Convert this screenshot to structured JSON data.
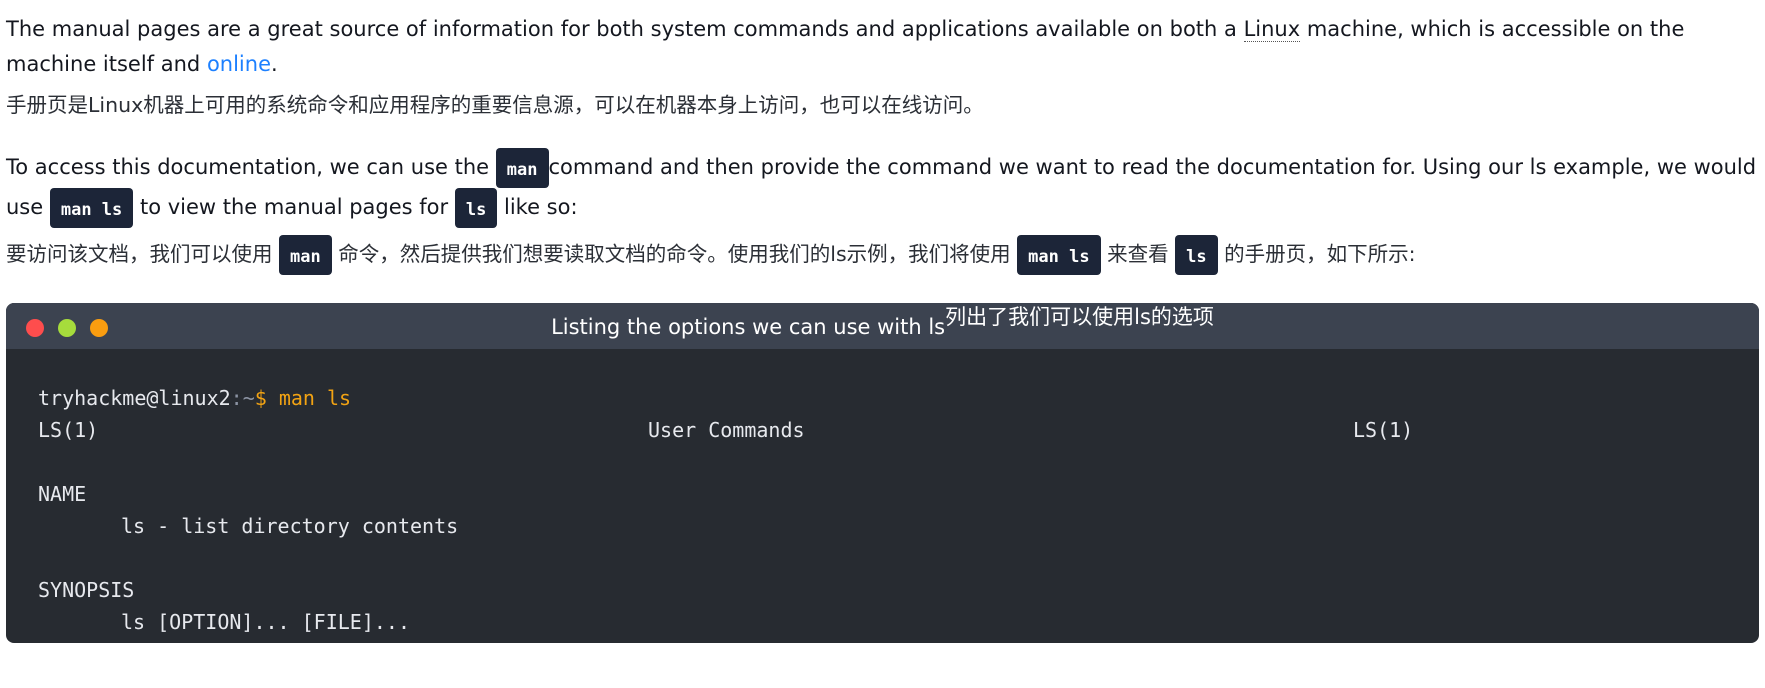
{
  "colors": {
    "link": "#1d80ff",
    "code_bg": "#1c2538",
    "terminal_bg": "#272b31",
    "titlebar_bg": "#3c4350",
    "dot_close": "#fe4d4d",
    "dot_min": "#a6dc3c",
    "dot_max": "#fa9d10",
    "prompt_accent": "#f2a313"
  },
  "para1": {
    "text_a": "The manual pages are a great source of information for both system commands and applications available on both a ",
    "abbr": "Linux",
    "text_b": " machine, which is accessible on the machine itself and ",
    "link": "online",
    "text_c": "."
  },
  "para1_zh": "手册页是Linux机器上可用的系统命令和应用程序的重要信息源，可以在机器本身上访问，也可以在线访问。",
  "para2": {
    "text_a": "To access this documentation, we can use the ",
    "code_a": "man",
    "text_b": "command and then provide the command we want to read the documentation for. Using our ls example, we would use ",
    "code_b": "man ls",
    "text_c": " to view the manual pages for ",
    "code_c": "ls",
    "text_d": " like so:"
  },
  "para2_zh": {
    "text_a": "要访问该文档，我们可以使用 ",
    "code_a": "man",
    "text_b": " 命令，然后提供我们想要读取文档的命令。使用我们的ls示例，我们将使用 ",
    "code_b": "man ls",
    "text_c": " 来查看 ",
    "code_c": "ls",
    "text_d": " 的手册页，如下所示:"
  },
  "terminal": {
    "title": "Listing the options we can use with ls",
    "title_zh": "列出了我们可以使用ls的选项",
    "prompt_user": "tryhackme@linux2",
    "prompt_path": ":~",
    "prompt_sign": "$",
    "command": " man ls",
    "header_left": "LS(1)",
    "header_center": "User Commands",
    "header_right": "LS(1)",
    "name_heading": "NAME",
    "name_text": "ls - list directory contents",
    "synopsis_heading": "SYNOPSIS",
    "synopsis_text": "ls [OPTION]... [FILE]..."
  }
}
